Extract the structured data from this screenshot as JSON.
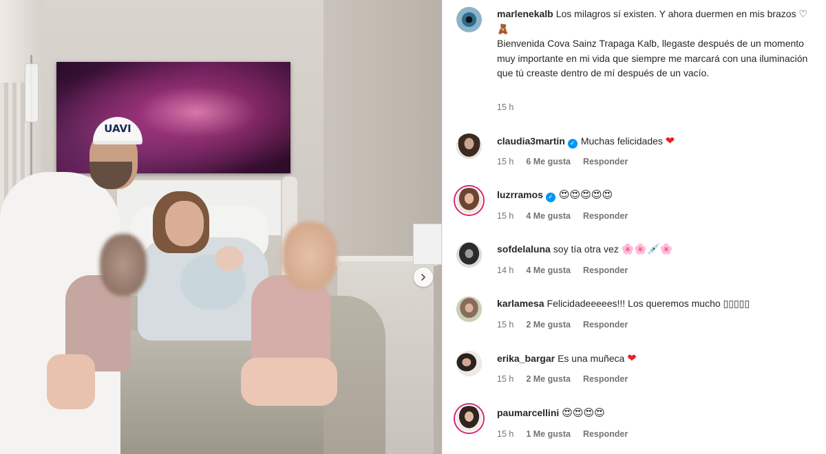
{
  "post": {
    "carousel_next_icon": "chevron-right-icon",
    "cap_text": "UAVI"
  },
  "caption": {
    "username": "marlenekalb",
    "line1": "Los milagros sí existen. Y ahora duermen en mis brazos ♡ 🧸",
    "line2": "Bienvenida Cova Sainz Trapaga Kalb, llegaste después de un momento muy importante en mi vida que siempre me marcará con una iluminación que tú creaste dentro de mí después de un vacío.",
    "time": "15 h"
  },
  "comments": [
    {
      "username": "claudia3martin",
      "verified": true,
      "text": "Muchas felicidades",
      "suffix": "❤",
      "time": "15 h",
      "likes": "6 Me gusta",
      "reply": "Responder"
    },
    {
      "username": "luzrramos",
      "verified": true,
      "text": "",
      "suffix": "😍😍😍😍😍",
      "time": "15 h",
      "likes": "4 Me gusta",
      "reply": "Responder"
    },
    {
      "username": "sofdelaluna",
      "verified": false,
      "text": "soy tía otra vez",
      "suffix": "🌸🌸💉🌸",
      "time": "14 h",
      "likes": "4 Me gusta",
      "reply": "Responder"
    },
    {
      "username": "karlamesa",
      "verified": false,
      "text": "Felicidadeeeees!!! Los queremos mucho",
      "suffix": "▯▯▯▯▯",
      "time": "15 h",
      "likes": "2 Me gusta",
      "reply": "Responder"
    },
    {
      "username": "erika_bargar",
      "verified": false,
      "text": "Es una muñeca",
      "suffix": "❤",
      "time": "15 h",
      "likes": "2 Me gusta",
      "reply": "Responder"
    },
    {
      "username": "paumarcellini",
      "verified": false,
      "text": "",
      "suffix": "😍😍😍😍",
      "time": "15 h",
      "likes": "1 Me gusta",
      "reply": "Responder"
    }
  ],
  "colors": {
    "verified": "#0095f6",
    "heart": "#ed1c24",
    "story_ring": "#d62976",
    "meta": "#737373"
  }
}
